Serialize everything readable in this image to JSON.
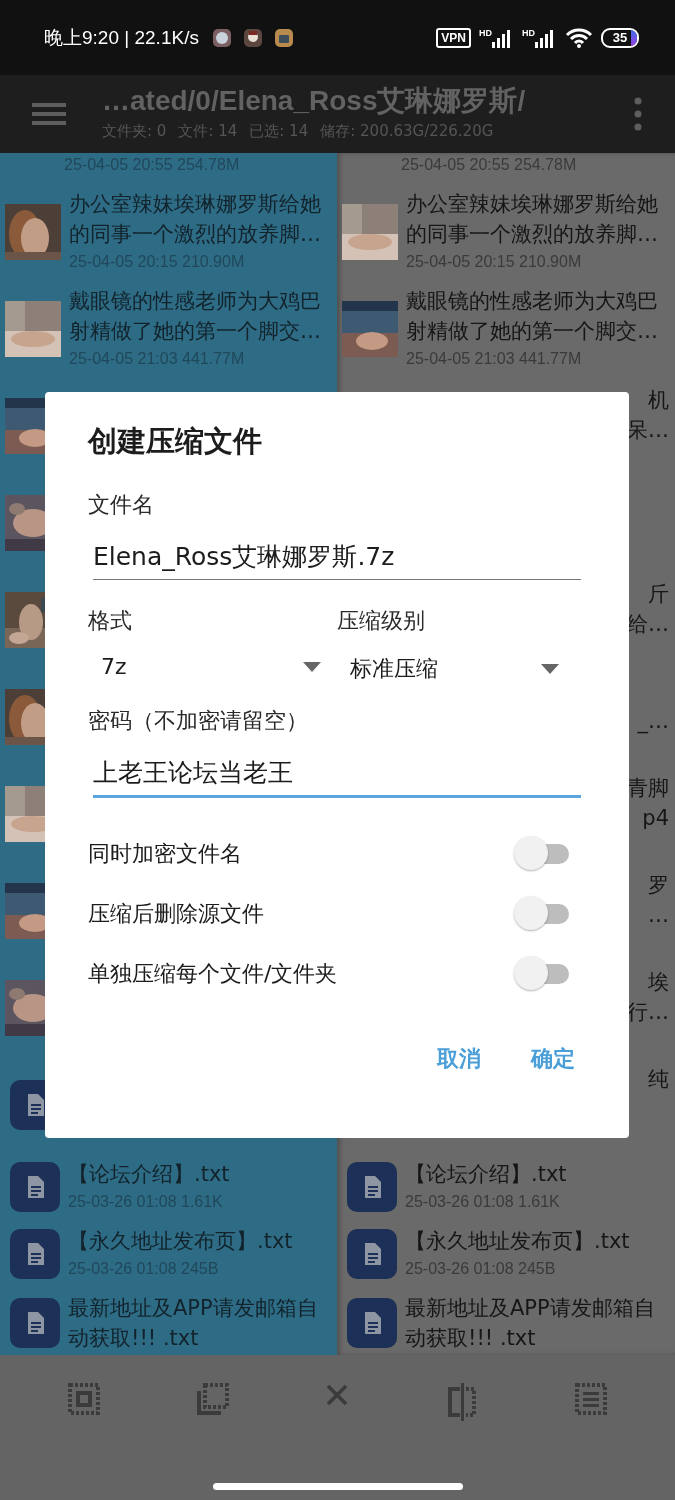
{
  "status_bar": {
    "time": "晚上9:20 | 22.1K/s",
    "vpn": "VPN",
    "signals": [
      "HD",
      "HD"
    ],
    "battery": "35"
  },
  "app_bar": {
    "path": "…ated/0/Elena_Ross艾琳娜罗斯/",
    "stats": [
      "文件夹: 0",
      "文件: 14",
      "已选: 14",
      "储存: 200.63G/226.20G"
    ]
  },
  "panes": [
    {
      "selected": true,
      "rows": [
        {
          "kind": "video",
          "meta": "25-04-05 20:55  254.78M"
        },
        {
          "kind": "video",
          "title": "办公室辣妹埃琳娜罗斯给她的同事一个激烈的放养脚…",
          "meta": "25-04-05 20:15  210.90M"
        },
        {
          "kind": "video",
          "title": "戴眼镜的性感老师为大鸡巴射精做了她的第一个脚交…",
          "meta": "25-04-05 21:03  441.77M"
        },
        {
          "kind": "video"
        },
        {
          "kind": "video"
        },
        {
          "kind": "video"
        },
        {
          "kind": "video"
        },
        {
          "kind": "video"
        },
        {
          "kind": "video"
        },
        {
          "kind": "video"
        },
        {
          "kind": "text"
        },
        {
          "kind": "text",
          "title": "【论坛介绍】.txt",
          "meta": "25-03-26 01:08  1.61K"
        },
        {
          "kind": "text",
          "title": "【永久地址发布页】.txt",
          "meta": "25-03-26 01:08  245B"
        },
        {
          "kind": "text",
          "title": "最新地址及APP请发邮箱自动获取!!! .txt"
        }
      ]
    },
    {
      "selected": false,
      "rows": [
        {
          "kind": "video",
          "meta": "25-04-05 20:55  254.78M"
        },
        {
          "kind": "video",
          "title": "办公室辣妹埃琳娜罗斯给她的同事一个激烈的放养脚…",
          "meta": "25-04-05 20:15  210.90M"
        },
        {
          "kind": "video",
          "title": "戴眼镜的性感老师为大鸡巴射精做了她的第一个脚交…",
          "meta": "25-04-05 21:03  441.77M"
        },
        {
          "kind": "covered",
          "line_1": "机",
          "line_2": "呆…"
        },
        {
          "kind": "covered"
        },
        {
          "kind": "covered",
          "line_1": "斤",
          "line_2": "给…"
        },
        {
          "kind": "covered",
          "line_2": "_…"
        },
        {
          "kind": "covered",
          "line_1": "青脚",
          "line_2": "p4"
        },
        {
          "kind": "covered",
          "line_1": "罗",
          "line_2": "…"
        },
        {
          "kind": "covered",
          "line_1": "埃",
          "line_2": "行…"
        },
        {
          "kind": "covered",
          "line_1": "纯"
        },
        {
          "kind": "text",
          "title": "【论坛介绍】.txt",
          "meta": "25-03-26 01:08  1.61K"
        },
        {
          "kind": "text",
          "title": "【永久地址发布页】.txt",
          "meta": "25-03-26 01:08  245B"
        },
        {
          "kind": "text",
          "title": "最新地址及APP请发邮箱自动获取!!! .txt"
        }
      ]
    }
  ],
  "dialog": {
    "title": "创建压缩文件",
    "filename": {
      "label": "文件名",
      "value": "Elena_Ross艾琳娜罗斯.7z",
      "focused": false
    },
    "format": {
      "label": "格式",
      "value": "7z"
    },
    "level": {
      "label": "压缩级别",
      "value": "标准压缩"
    },
    "password": {
      "label": "密码（不加密请留空）",
      "value": "上老王论坛当老王",
      "focused": true
    },
    "switches": [
      {
        "label": "同时加密文件名",
        "on": false
      },
      {
        "label": "压缩后删除源文件",
        "on": false
      },
      {
        "label": "单独压缩每个文件/文件夹",
        "on": false
      }
    ],
    "buttons": [
      "取消",
      "确定"
    ]
  }
}
